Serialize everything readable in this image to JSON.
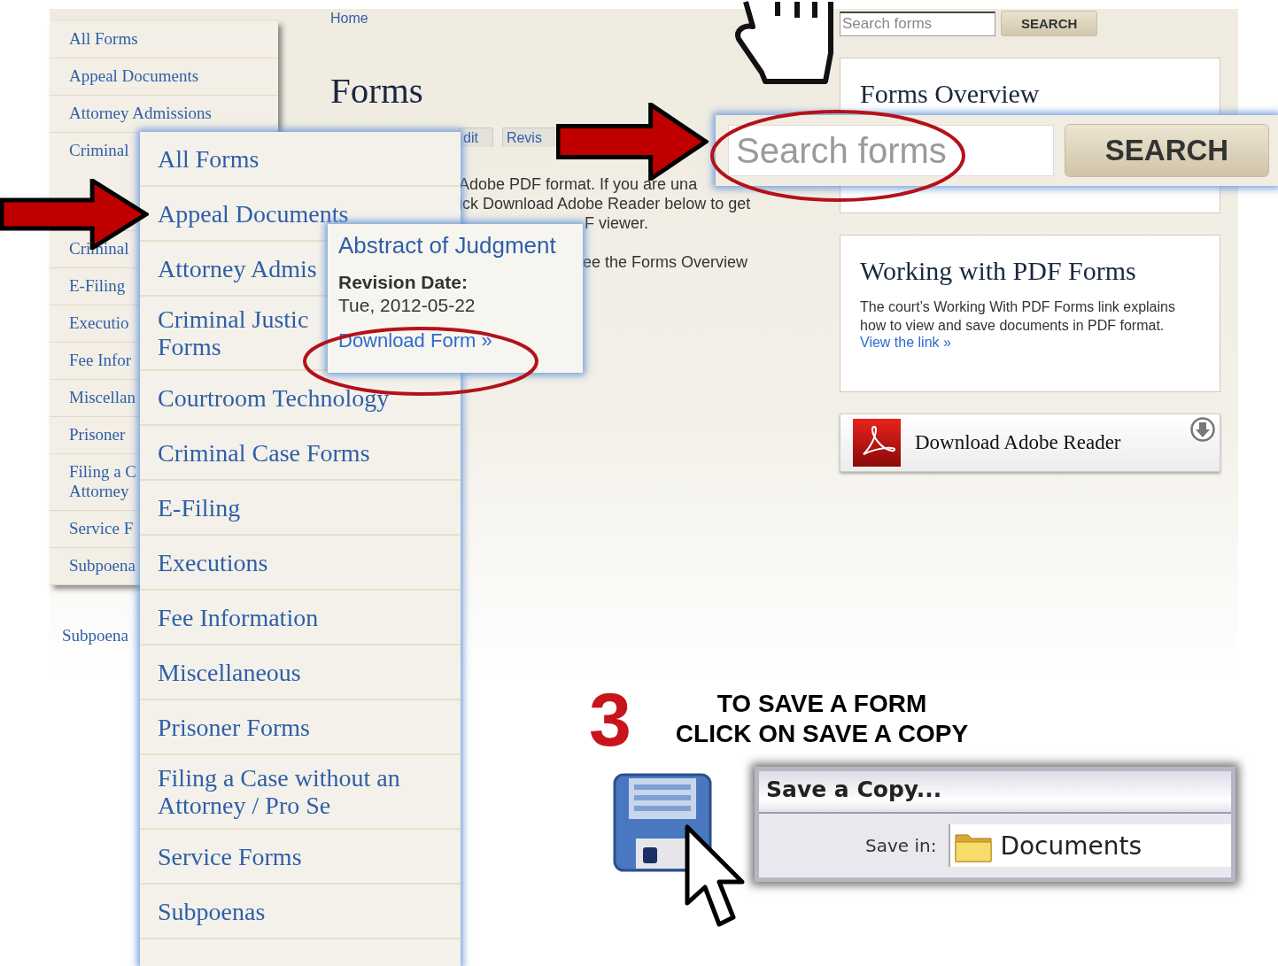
{
  "page": {
    "breadcrumb": "Home",
    "title": "Forms",
    "tabs": [
      "dit",
      "Revis"
    ],
    "intro_fragments": [
      "Adobe PDF format. If you are una",
      "ick Download Adobe Reader below to get",
      "F viewer.",
      "ee the Forms Overview"
    ]
  },
  "sidebar": {
    "items": [
      "All Forms",
      "Appeal Documents",
      "Attorney Admissions"
    ],
    "partial_items": [
      "Criminal",
      "Criminal",
      "E-Filing",
      "Executio",
      "Fee Infor",
      "Miscellan",
      "Prisoner",
      "Filing a C Attorney",
      "Service F",
      "Subpoena"
    ],
    "footer_link": "Subpoena"
  },
  "search": {
    "placeholder": "Search forms",
    "button": "SEARCH"
  },
  "forms_overview": {
    "title": "Forms Overview"
  },
  "pdf_card": {
    "title": "Working with PDF Forms",
    "text": "The court’s Working With PDF Forms link explains how to view and save documents in PDF format.",
    "link": "View the link »"
  },
  "adobe_button": {
    "label": "Download Adobe Reader"
  },
  "menu_popup": {
    "items": [
      "All Forms",
      "Appeal Documents",
      "Attorney Admis",
      "Criminal Justic Forms",
      "Courtroom Technology",
      "Criminal Case Forms",
      "E-Filing",
      "Executions",
      "Fee Information",
      "Miscellaneous",
      "Prisoner Forms",
      "Filing a Case without an Attorney / Pro Se",
      "Service Forms",
      "Subpoenas"
    ]
  },
  "tooltip": {
    "title": "Abstract of Judgment",
    "date_label": "Revision Date:",
    "date": "Tue, 2012-05-22",
    "link": "Download Form »"
  },
  "search_zoom": {
    "placeholder": "Search forms",
    "button": "SEARCH"
  },
  "step": {
    "number": "3",
    "lines": [
      "TO SAVE A FORM",
      "CLICK ON SAVE A COPY"
    ]
  },
  "save_dialog": {
    "title": "Save a Copy...",
    "field_label": "Save in:",
    "folder": "Documents"
  }
}
